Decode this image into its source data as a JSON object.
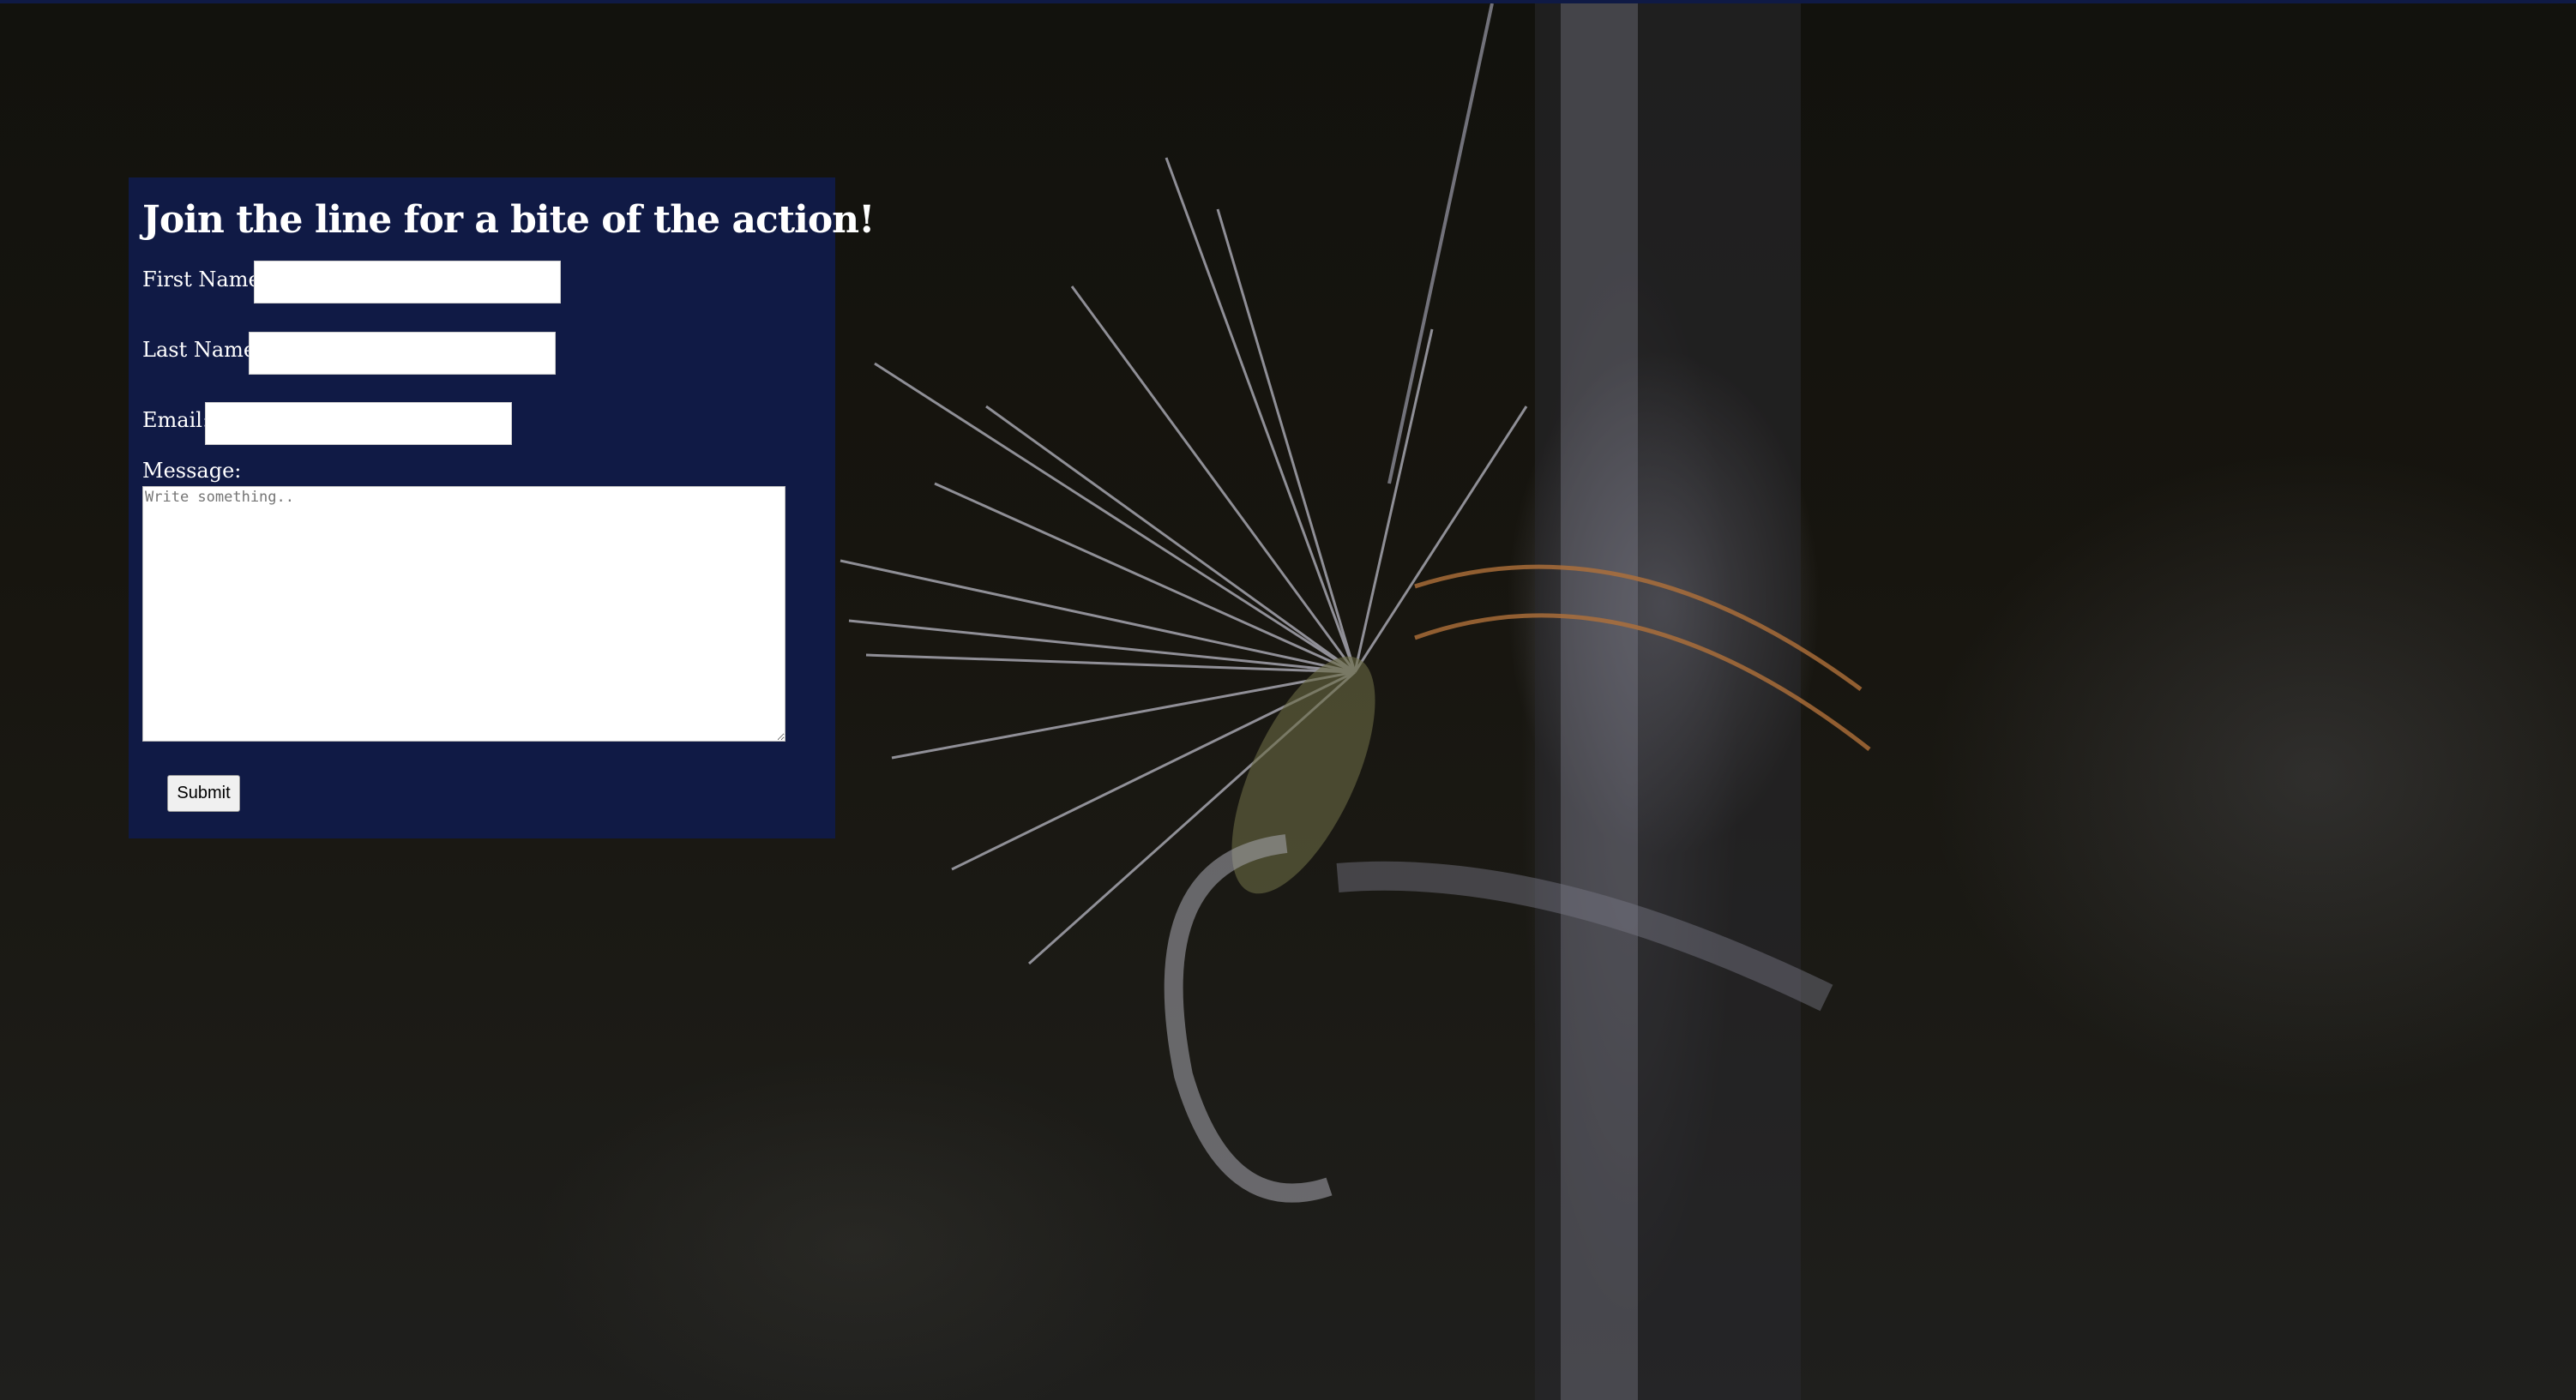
{
  "form": {
    "title": "Join the line for a bite of the action!",
    "first_name_label": "First Name:",
    "first_name_value": "",
    "last_name_label": "Last Name:",
    "last_name_value": "",
    "email_label": "Email:",
    "email_value": "",
    "message_label": "Message:",
    "message_placeholder": "Write something..",
    "submit_label": "Submit"
  },
  "colors": {
    "panel_background": "#101a45",
    "text": "#ffffff",
    "page_background": "#0d0d0a"
  },
  "background": {
    "image_subject": "fly-fishing-fly-on-rod"
  }
}
